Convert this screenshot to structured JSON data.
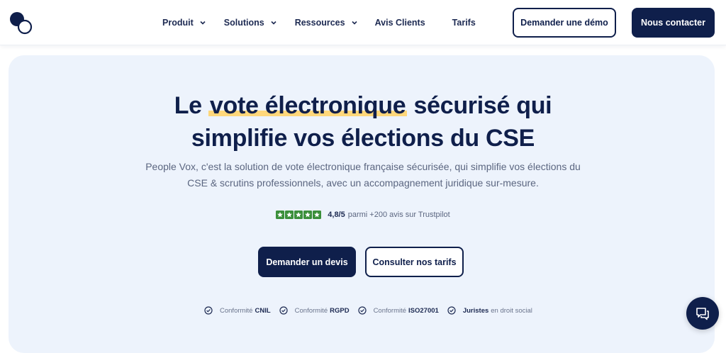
{
  "header": {
    "nav": [
      {
        "label": "Produit",
        "has_dropdown": true
      },
      {
        "label": "Solutions",
        "has_dropdown": true
      },
      {
        "label": "Ressources",
        "has_dropdown": true
      },
      {
        "label": "Avis Clients",
        "has_dropdown": false
      },
      {
        "label": "Tarifs",
        "has_dropdown": false
      }
    ],
    "demo_label": "Demander une démo",
    "contact_label": "Nous contacter"
  },
  "hero": {
    "title_pre": "Le ",
    "title_highlight": "vote électronique",
    "title_post": " sécurisé qui",
    "title_line2": "simplifie vos élections du CSE",
    "subtitle_line1": "People Vox, c'est la solution de vote électronique française sécurisée, qui simplifie vos élections du",
    "subtitle_line2": "CSE & scrutins professionnels, avec un accompagnement juridique sur-mesure.",
    "rating_score": "4,8/5",
    "rating_text": "parmi +200 avis sur Trustpilot",
    "rating_stars": 5,
    "cta_primary": "Demander un devis",
    "cta_secondary": "Consulter nos tarifs"
  },
  "badges": [
    {
      "pre": "Conformité",
      "bold": "CNIL",
      "post": ""
    },
    {
      "pre": "Conformité",
      "bold": "RGPD",
      "post": ""
    },
    {
      "pre": "Conformité",
      "bold": "ISO27001",
      "post": ""
    },
    {
      "pre": "",
      "bold": "Juristes",
      "post": "en droit social"
    }
  ],
  "colors": {
    "navy": "#0f1f4b",
    "hero_bg": "#edf3fc",
    "highlight": "#ffd77a",
    "star_green": "#3a8f3a"
  },
  "icons": {
    "logo": "people-vox-logo",
    "chevron": "chevron-down-icon",
    "star": "star-icon",
    "check": "check-circle-icon",
    "chat": "chat-icon"
  }
}
